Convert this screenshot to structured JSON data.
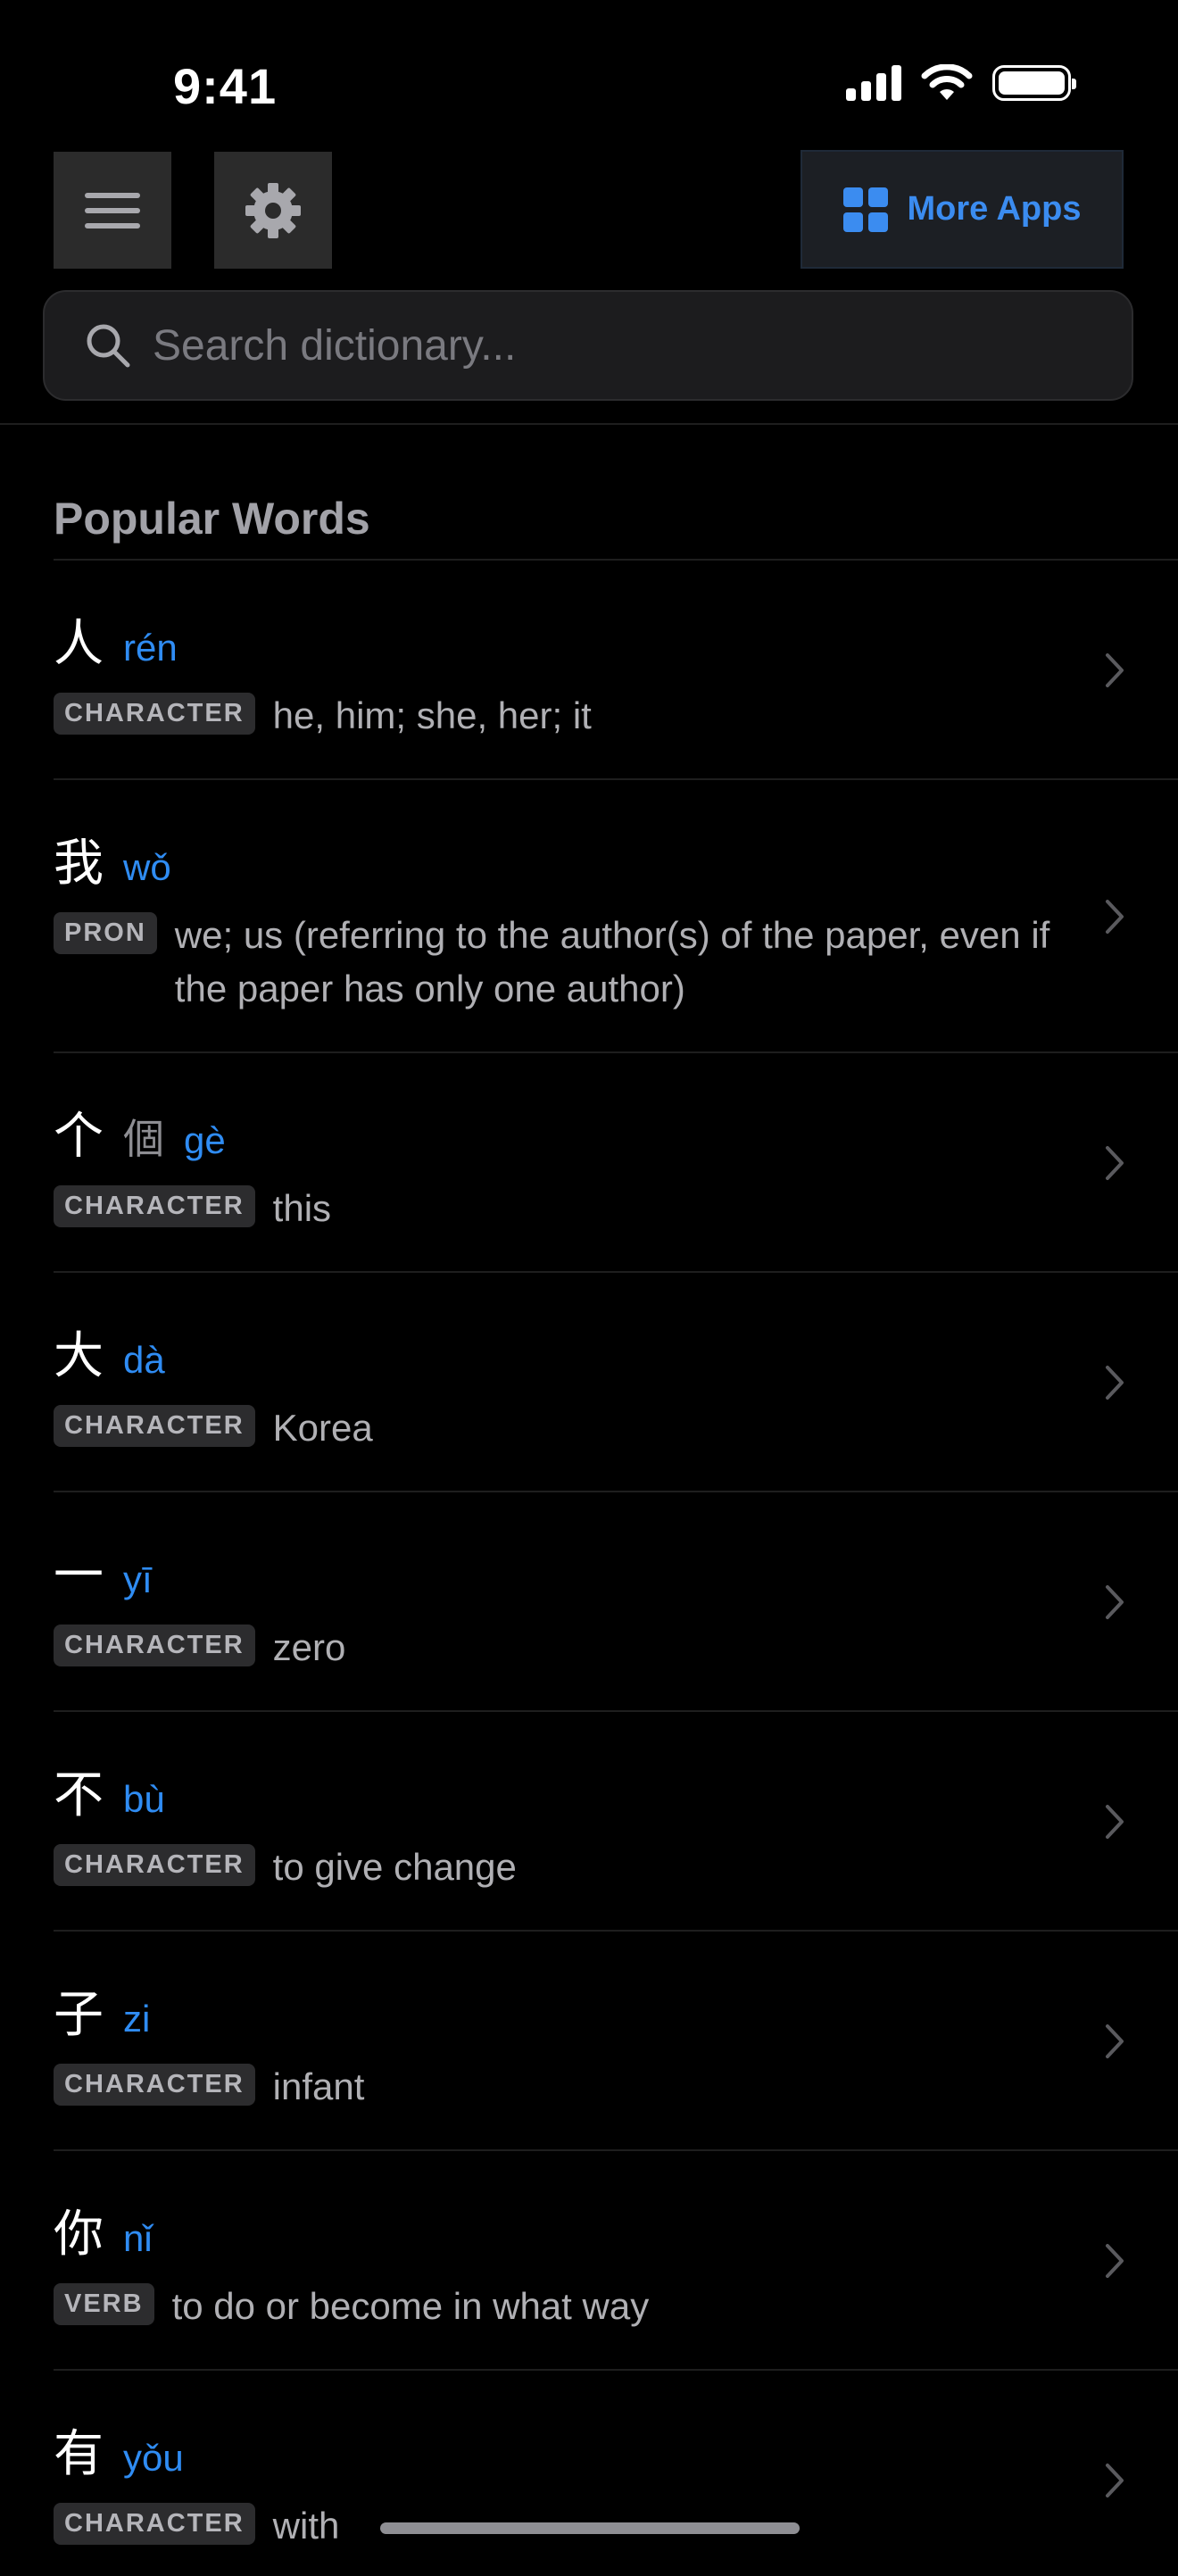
{
  "status": {
    "time": "9:41"
  },
  "toolbar": {
    "more_apps_label": "More Apps"
  },
  "search": {
    "placeholder": "Search dictionary..."
  },
  "section": {
    "title": "Popular Words"
  },
  "words": [
    {
      "hanzi": "人",
      "trad": "",
      "pinyin": "rén",
      "tag": "CHARACTER",
      "definition": "he, him; she, her; it"
    },
    {
      "hanzi": "我",
      "trad": "",
      "pinyin": "wǒ",
      "tag": "PRON",
      "definition": "we; us (referring to the author(s) of the paper, even if the paper has only one author)"
    },
    {
      "hanzi": "个",
      "trad": "個",
      "pinyin": "gè",
      "tag": "CHARACTER",
      "definition": "this"
    },
    {
      "hanzi": "大",
      "trad": "",
      "pinyin": "dà",
      "tag": "CHARACTER",
      "definition": "Korea"
    },
    {
      "hanzi": "一",
      "trad": "",
      "pinyin": "yī",
      "tag": "CHARACTER",
      "definition": "zero"
    },
    {
      "hanzi": "不",
      "trad": "",
      "pinyin": "bù",
      "tag": "CHARACTER",
      "definition": "to give change"
    },
    {
      "hanzi": "子",
      "trad": "",
      "pinyin": "zi",
      "tag": "CHARACTER",
      "definition": "infant"
    },
    {
      "hanzi": "你",
      "trad": "",
      "pinyin": "nǐ",
      "tag": "VERB",
      "definition": "to do or become in what way"
    },
    {
      "hanzi": "有",
      "trad": "",
      "pinyin": "yǒu",
      "tag": "CHARACTER",
      "definition": "with"
    }
  ]
}
